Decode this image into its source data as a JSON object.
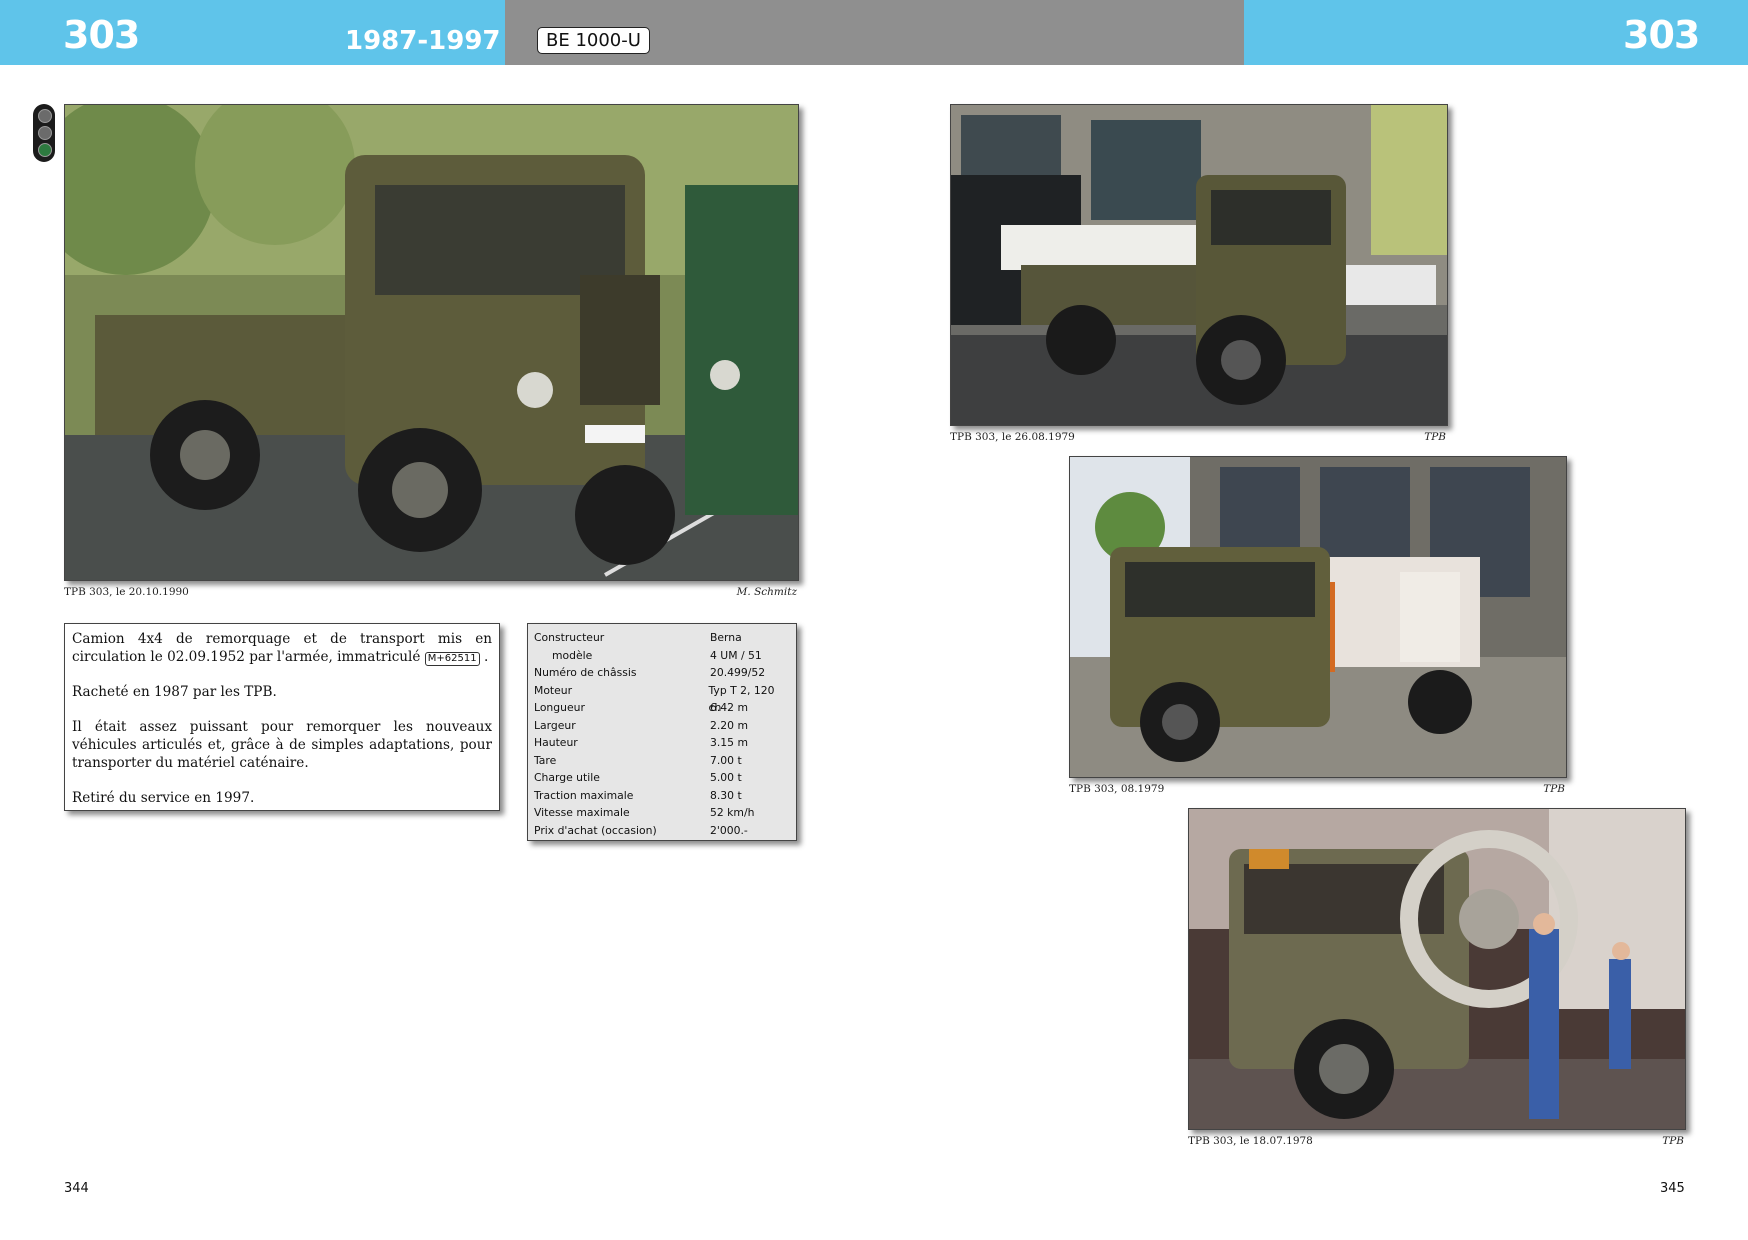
{
  "header": {
    "left_number": "303",
    "years": "1987-1997",
    "plate": "BE 1000-U",
    "right_number": "303"
  },
  "photos": [
    {
      "caption": "TPB 303, le 20.10.1990",
      "credit": "M. Schmitz",
      "description": "Olive military Berna truck in front of green buses"
    },
    {
      "caption": "TPB 303, le 26.08.1979",
      "credit": "TPB",
      "description": "Truck carrying load in front of depot"
    },
    {
      "caption": "TPB 303, 08.1979",
      "credit": "TPB",
      "description": "Truck with cable reel in front of depot"
    },
    {
      "caption": "TPB 303, le 18.07.1978",
      "credit": "TPB",
      "description": "Workers loading cable drum onto truck"
    }
  ],
  "text": {
    "p1_before": "Camion 4x4 de remorquage et de transport mis en circulation le 02.09.1952 par l'armée, immatriculé",
    "p1_plate": "M+62511",
    "p1_after": ".",
    "p2": "Racheté en 1987 par les TPB.",
    "p3": "Il était assez puissant pour remorquer les nouveaux véhicules articulés et, grâce à de simples adaptations, pour transporter du matériel caténaire.",
    "p4": "Retiré du service en 1997."
  },
  "specs": [
    {
      "label": "Constructeur",
      "value": "Berna",
      "indent": false
    },
    {
      "label": "modèle",
      "value": "4 UM / 51",
      "indent": true
    },
    {
      "label": "Numéro de châssis",
      "value": "20.499/52",
      "indent": false
    },
    {
      "label": "Moteur",
      "value": "Typ T 2, 120 ch",
      "indent": false
    },
    {
      "label": "Longueur",
      "value": "6.42 m",
      "indent": false
    },
    {
      "label": "Largeur",
      "value": "2.20 m",
      "indent": false
    },
    {
      "label": "Hauteur",
      "value": "3.15 m",
      "indent": false
    },
    {
      "label": "Tare",
      "value": "7.00 t",
      "indent": false
    },
    {
      "label": "Charge utile",
      "value": "5.00 t",
      "indent": false
    },
    {
      "label": "Traction maximale",
      "value": "8.30 t",
      "indent": false
    },
    {
      "label": "Vitesse maximale",
      "value": "52 km/h",
      "indent": false
    },
    {
      "label": "Prix d'achat (occasion)",
      "value": "2'000.-",
      "indent": false
    }
  ],
  "page_left": "344",
  "page_right": "345",
  "colors": {
    "header_blue": "#5fc4ea",
    "header_grey": "#8f8f8f",
    "truck_olive": "#5b5a3a"
  }
}
